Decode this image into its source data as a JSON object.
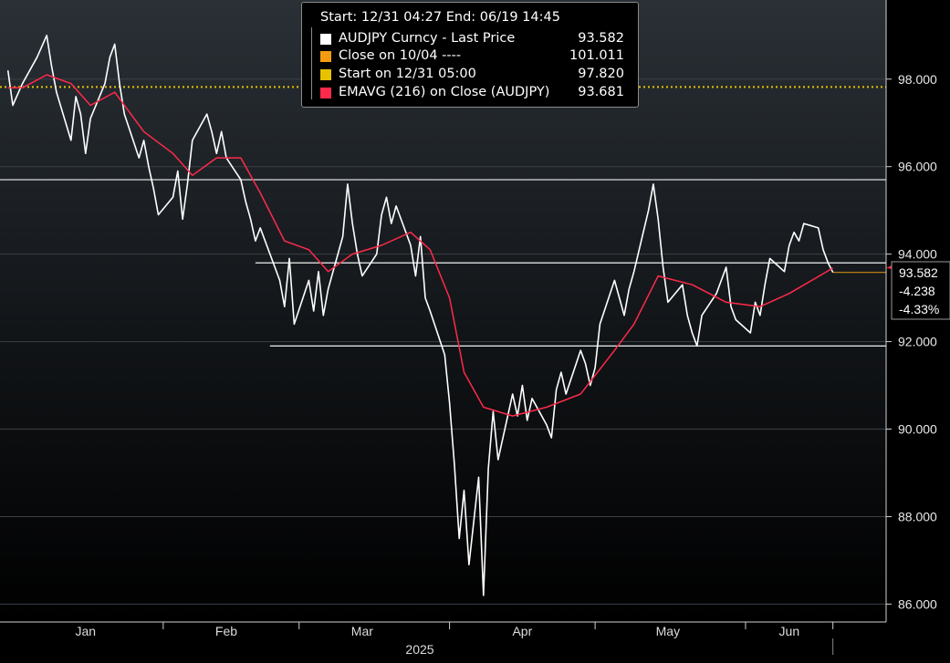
{
  "chart_data": {
    "type": "line",
    "header": {
      "start_label": "Start: 12/31 04:27",
      "end_label": "End: 06/19 14:45"
    },
    "legend": [
      {
        "label": "AUDJPY Curncy - Last Price",
        "value": "93.582",
        "color": "#ffffff"
      },
      {
        "label": "Close on 10/04 ----",
        "value": "101.011",
        "color": "#f39c12"
      },
      {
        "label": "Start on 12/31 05:00",
        "value": "97.820",
        "color": "#e6c200"
      },
      {
        "label": "EMAVG (216) on Close (AUDJPY)",
        "value": "93.681",
        "color": "#ff2a4a"
      }
    ],
    "x_axis": {
      "labels": [
        "Jan",
        "Feb",
        "Mar",
        "Apr",
        "May",
        "Jun"
      ],
      "year_label": "2025"
    },
    "y_axis": {
      "ticks": [
        "86.000",
        "88.000",
        "90.000",
        "92.000",
        "94.000",
        "96.000",
        "98.000"
      ],
      "range": [
        85.8,
        99.6
      ],
      "side": "right"
    },
    "reference_lines": [
      {
        "value": 97.82,
        "style": "dotted",
        "color": "#e6c200"
      }
    ],
    "horizontal_levels": [
      {
        "value": 95.7,
        "start": "Jan 01"
      },
      {
        "value": 93.8,
        "start": "Feb 20"
      },
      {
        "value": 91.9,
        "start": "Feb 23"
      }
    ],
    "last_price_tag": {
      "value": "93.582",
      "change": "-4.238",
      "change_pct": "-4.33%"
    },
    "grid": "horizontal",
    "series": [
      {
        "name": "AUDJPY Curncy - Last Price",
        "color": "#ffffff",
        "points": [
          [
            "2024-12-31",
            98.2
          ],
          [
            "2025-01-01",
            97.4
          ],
          [
            "2025-01-03",
            97.9
          ],
          [
            "2025-01-06",
            98.5
          ],
          [
            "2025-01-08",
            99.0
          ],
          [
            "2025-01-09",
            98.3
          ],
          [
            "2025-01-10",
            97.7
          ],
          [
            "2025-01-13",
            96.6
          ],
          [
            "2025-01-14",
            97.6
          ],
          [
            "2025-01-15",
            97.2
          ],
          [
            "2025-01-16",
            96.3
          ],
          [
            "2025-01-17",
            97.1
          ],
          [
            "2025-01-20",
            97.9
          ],
          [
            "2025-01-21",
            98.5
          ],
          [
            "2025-01-22",
            98.8
          ],
          [
            "2025-01-23",
            97.9
          ],
          [
            "2025-01-24",
            97.2
          ],
          [
            "2025-01-27",
            96.2
          ],
          [
            "2025-01-28",
            96.6
          ],
          [
            "2025-01-29",
            96.0
          ],
          [
            "2025-01-30",
            95.5
          ],
          [
            "2025-01-31",
            94.9
          ],
          [
            "2025-02-03",
            95.3
          ],
          [
            "2025-02-04",
            95.9
          ],
          [
            "2025-02-05",
            94.8
          ],
          [
            "2025-02-06",
            95.6
          ],
          [
            "2025-02-07",
            96.6
          ],
          [
            "2025-02-10",
            97.2
          ],
          [
            "2025-02-11",
            96.8
          ],
          [
            "2025-02-12",
            96.3
          ],
          [
            "2025-02-13",
            96.8
          ],
          [
            "2025-02-14",
            96.2
          ],
          [
            "2025-02-17",
            95.7
          ],
          [
            "2025-02-18",
            95.2
          ],
          [
            "2025-02-19",
            94.8
          ],
          [
            "2025-02-20",
            94.3
          ],
          [
            "2025-02-21",
            94.6
          ],
          [
            "2025-02-24",
            93.7
          ],
          [
            "2025-02-25",
            93.4
          ],
          [
            "2025-02-26",
            92.8
          ],
          [
            "2025-02-27",
            93.9
          ],
          [
            "2025-02-28",
            92.4
          ],
          [
            "2025-03-03",
            93.4
          ],
          [
            "2025-03-04",
            92.7
          ],
          [
            "2025-03-05",
            93.6
          ],
          [
            "2025-03-06",
            92.6
          ],
          [
            "2025-03-07",
            93.2
          ],
          [
            "2025-03-10",
            94.4
          ],
          [
            "2025-03-11",
            95.6
          ],
          [
            "2025-03-12",
            94.7
          ],
          [
            "2025-03-13",
            94.0
          ],
          [
            "2025-03-14",
            93.5
          ],
          [
            "2025-03-17",
            94.0
          ],
          [
            "2025-03-18",
            94.9
          ],
          [
            "2025-03-19",
            95.3
          ],
          [
            "2025-03-20",
            94.7
          ],
          [
            "2025-03-21",
            95.1
          ],
          [
            "2025-03-24",
            94.2
          ],
          [
            "2025-03-25",
            93.5
          ],
          [
            "2025-03-26",
            94.4
          ],
          [
            "2025-03-27",
            93.0
          ],
          [
            "2025-03-28",
            92.7
          ],
          [
            "2025-03-31",
            91.7
          ],
          [
            "2025-04-01",
            90.6
          ],
          [
            "2025-04-02",
            89.2
          ],
          [
            "2025-04-03",
            87.5
          ],
          [
            "2025-04-04",
            88.6
          ],
          [
            "2025-04-05",
            86.9
          ],
          [
            "2025-04-07",
            88.9
          ],
          [
            "2025-04-08",
            86.2
          ],
          [
            "2025-04-09",
            89.1
          ],
          [
            "2025-04-10",
            90.4
          ],
          [
            "2025-04-11",
            89.3
          ],
          [
            "2025-04-14",
            90.8
          ],
          [
            "2025-04-15",
            90.3
          ],
          [
            "2025-04-16",
            91.0
          ],
          [
            "2025-04-17",
            90.2
          ],
          [
            "2025-04-18",
            90.7
          ],
          [
            "2025-04-21",
            90.1
          ],
          [
            "2025-04-22",
            89.8
          ],
          [
            "2025-04-23",
            90.9
          ],
          [
            "2025-04-24",
            91.3
          ],
          [
            "2025-04-25",
            90.8
          ],
          [
            "2025-04-28",
            91.8
          ],
          [
            "2025-04-29",
            91.5
          ],
          [
            "2025-04-30",
            91.0
          ],
          [
            "2025-05-01",
            91.4
          ],
          [
            "2025-05-02",
            92.4
          ],
          [
            "2025-05-05",
            93.4
          ],
          [
            "2025-05-06",
            93.0
          ],
          [
            "2025-05-07",
            92.6
          ],
          [
            "2025-05-08",
            93.2
          ],
          [
            "2025-05-09",
            93.6
          ],
          [
            "2025-05-12",
            95.0
          ],
          [
            "2025-05-13",
            95.6
          ],
          [
            "2025-05-14",
            94.8
          ],
          [
            "2025-05-15",
            93.7
          ],
          [
            "2025-05-16",
            92.9
          ],
          [
            "2025-05-19",
            93.3
          ],
          [
            "2025-05-20",
            92.6
          ],
          [
            "2025-05-21",
            92.2
          ],
          [
            "2025-05-22",
            91.9
          ],
          [
            "2025-05-23",
            92.6
          ],
          [
            "2025-05-26",
            93.1
          ],
          [
            "2025-05-27",
            93.4
          ],
          [
            "2025-05-28",
            93.7
          ],
          [
            "2025-05-29",
            92.8
          ],
          [
            "2025-05-30",
            92.5
          ],
          [
            "2025-06-02",
            92.2
          ],
          [
            "2025-06-03",
            92.9
          ],
          [
            "2025-06-04",
            92.6
          ],
          [
            "2025-06-05",
            93.3
          ],
          [
            "2025-06-06",
            93.9
          ],
          [
            "2025-06-09",
            93.6
          ],
          [
            "2025-06-10",
            94.2
          ],
          [
            "2025-06-11",
            94.5
          ],
          [
            "2025-06-12",
            94.3
          ],
          [
            "2025-06-13",
            94.7
          ],
          [
            "2025-06-16",
            94.6
          ],
          [
            "2025-06-17",
            94.1
          ],
          [
            "2025-06-18",
            93.8
          ],
          [
            "2025-06-19",
            93.582
          ]
        ]
      },
      {
        "name": "EMAVG (216) on Close (AUDJPY)",
        "color": "#ff2a4a",
        "points": [
          [
            "2024-12-31",
            97.8
          ],
          [
            "2025-01-03",
            97.8
          ],
          [
            "2025-01-08",
            98.1
          ],
          [
            "2025-01-13",
            97.9
          ],
          [
            "2025-01-17",
            97.4
          ],
          [
            "2025-01-22",
            97.7
          ],
          [
            "2025-01-28",
            96.8
          ],
          [
            "2025-02-03",
            96.3
          ],
          [
            "2025-02-07",
            95.8
          ],
          [
            "2025-02-12",
            96.2
          ],
          [
            "2025-02-17",
            96.2
          ],
          [
            "2025-02-21",
            95.4
          ],
          [
            "2025-02-26",
            94.3
          ],
          [
            "2025-03-03",
            94.1
          ],
          [
            "2025-03-07",
            93.6
          ],
          [
            "2025-03-12",
            94.0
          ],
          [
            "2025-03-18",
            94.2
          ],
          [
            "2025-03-24",
            94.5
          ],
          [
            "2025-03-28",
            94.1
          ],
          [
            "2025-04-01",
            93.0
          ],
          [
            "2025-04-04",
            91.3
          ],
          [
            "2025-04-08",
            90.5
          ],
          [
            "2025-04-14",
            90.3
          ],
          [
            "2025-04-21",
            90.5
          ],
          [
            "2025-04-28",
            90.8
          ],
          [
            "2025-05-05",
            91.8
          ],
          [
            "2025-05-09",
            92.4
          ],
          [
            "2025-05-14",
            93.5
          ],
          [
            "2025-05-21",
            93.3
          ],
          [
            "2025-05-28",
            92.9
          ],
          [
            "2025-06-04",
            92.8
          ],
          [
            "2025-06-10",
            93.1
          ],
          [
            "2025-06-19",
            93.681
          ]
        ]
      }
    ]
  }
}
